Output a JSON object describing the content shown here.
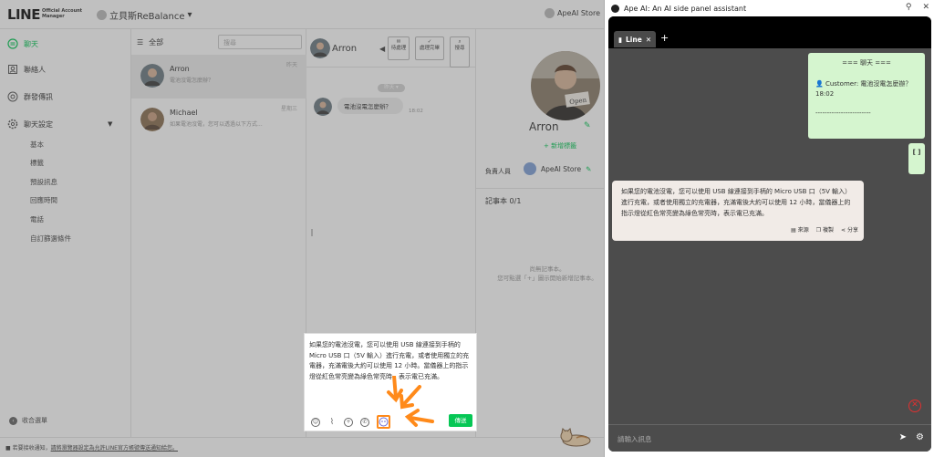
{
  "app": {
    "logo": "LINE",
    "logo_sub": "Official Account Manager",
    "account": "立貝斯ReBalance",
    "store": "ApeAI Store"
  },
  "sidebar": {
    "items": [
      {
        "label": "聊天",
        "icon": "chat-icon",
        "active": true
      },
      {
        "label": "聯絡人",
        "icon": "contacts-icon"
      },
      {
        "label": "群發傳訊",
        "icon": "broadcast-icon"
      },
      {
        "label": "聊天設定",
        "icon": "gear-icon"
      }
    ],
    "sub_items": [
      "基本",
      "標籤",
      "預設訊息",
      "回應時間",
      "電話",
      "自訂篩選條件"
    ],
    "collapse": "收合選單"
  },
  "chat_list": {
    "filter": "全部",
    "search_placeholder": "搜尋",
    "items": [
      {
        "name": "Arron",
        "preview": "電池沒電怎麼辦？",
        "time": "昨天"
      },
      {
        "name": "Michael",
        "preview": "如果電池沒電，您可以透過以下方式...",
        "time": "星期三"
      }
    ]
  },
  "conversation": {
    "name": "Arron",
    "buttons": [
      "待處理",
      "處理完畢",
      "搜尋"
    ],
    "date": "昨天 ▾",
    "message": "電池沒電怎麼辦？",
    "message_time": "18:02",
    "compose_text": "如果您的電池沒電，您可以使用 USB 線連接到手柄的 Micro USB 口（5V 輸入）進行充電，或者使用獨立的充電器，充滿電後大約可以使用 12 小時。當儀器上的指示燈從紅色常亮變為綠色常亮時，表示電已充滿。",
    "send": "傳送"
  },
  "profile": {
    "name": "Arron",
    "add_tag": "+ 新增標籤",
    "owner_label": "負責人員",
    "owner": "ApeAI Store",
    "notes_label": "記事本 0/1",
    "notes_empty_1": "尚無記事本。",
    "notes_empty_2": "您可點選「+」圖示開始新增記事本。"
  },
  "footer": {
    "notice": "■ 若要接收通知，",
    "link": "請將瀏覽器設定為允許LINE官方帳號傳送通知給您。"
  },
  "ape": {
    "title": "Ape AI: An AI side panel assistant",
    "tab": "Line",
    "summary_title": "=== 聊天 ===",
    "summary_line": "Customer: 電池沒電怎麼辦？ 18:02",
    "summary_sep": "------------------------",
    "small": "[ ]",
    "reply": "如果您的電池沒電，您可以使用 USB 線連接到手柄的 Micro USB 口（5V 輸入）進行充電，或者使用獨立的充電器，充滿電後大約可以使用 12 小時，當儀器上的指示燈從紅色常亮變為綠色常亮時，表示電已充滿。",
    "actions": [
      "來源",
      "複製",
      "分享"
    ],
    "input_placeholder": "請輸入訊息"
  }
}
